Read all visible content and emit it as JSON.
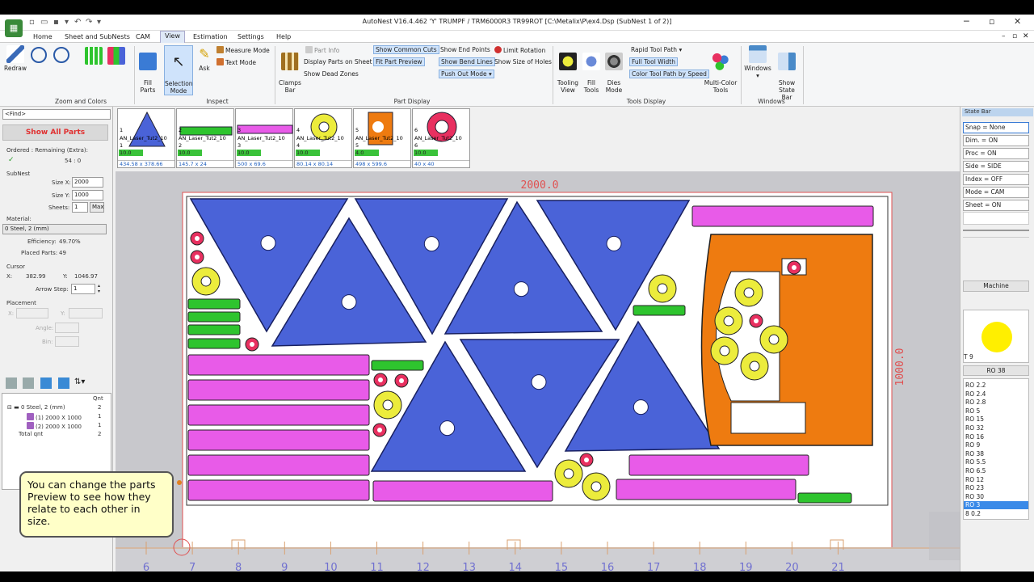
{
  "app": {
    "title": "AutoNest V16.4.462  'Y'  TRUMPF / TRM6000R3  TR99ROT    [C:\\Metalix\\P\\ex4.Dsp (SubNest 1 of 2)]",
    "menu": [
      "Home",
      "Sheet and SubNests",
      "CAM",
      "View",
      "Estimation",
      "Settings",
      "Help"
    ],
    "active_menu": "View"
  },
  "ribbon": {
    "redraw": "Redraw",
    "zoom_group": "Zoom and Colors",
    "fill_parts": "Fill\nParts",
    "selection_mode": "Selection\nMode",
    "ask": "Ask",
    "measure_mode": "Measure Mode",
    "text_mode": "Text Mode",
    "inspect_group": "Inspect",
    "clamps_bar": "Clamps\nBar",
    "part_info": "Part Info",
    "display_parts_on_sheet": "Display Parts on Sheet",
    "show_dead_zones": "Show Dead Zones",
    "show_common_cuts": "Show Common Cuts",
    "fit_part_preview": "Fit Part Preview",
    "show_end_points": "Show End Points",
    "show_bend_lines": "Show Bend Lines",
    "push_out_mode": "Push Out Mode",
    "limit_rotation": "Limit Rotation",
    "show_size_of_holes": "Show Size of Holes",
    "part_display_group": "Part Display",
    "tooling_view": "Tooling\nView",
    "fill_tools": "Fill\nTools",
    "dies_mode": "Dies\nMode",
    "rapid_tool_path": "Rapid Tool Path",
    "full_tool_width": "Full Tool Width",
    "color_tool_path_by_speed": "Color Tool Path by Speed",
    "multi_color_tools": "Multi-Color\nTools",
    "tools_display_group": "Tools Display",
    "windows": "Windows",
    "show_state_bar": "Show\nState Bar",
    "windows_group": "Windows"
  },
  "left_panel": {
    "find": "<Find>",
    "show_all_parts": "Show All Parts",
    "ordered_label": "Ordered : Remaining (Extra):",
    "ordered_value": "54 : 0",
    "subnest_label": "SubNest",
    "size_x_label": "Size X:",
    "size_x": "2000",
    "size_y_label": "Size Y:",
    "size_y": "1000",
    "sheets_label": "Sheets:",
    "sheets": "1",
    "max": "Max",
    "material_label": "Material:",
    "material": "0  Steel, 2 (mm)",
    "efficiency_label": "Efficiency:",
    "efficiency": "49.70%",
    "placed_parts_label": "Placed Parts:",
    "placed_parts": "49",
    "cursor_label": "Cursor",
    "cursor_x_label": "X:",
    "cursor_x": "382.99",
    "cursor_y_label": "Y:",
    "cursor_y": "1046.97",
    "arrow_step_label": "Arrow Step:",
    "arrow_step": "1",
    "placement_label": "Placement",
    "px_label": "X:",
    "py_label": "Y:",
    "angle_label": "Angle:",
    "bin_label": "Bin:",
    "tree_header_qnt": "Qnt",
    "tree": [
      {
        "label": "0  Steel, 2 (mm)",
        "qnt": "2"
      },
      {
        "label": "(1) 2000 X 1000",
        "qnt": "1"
      },
      {
        "label": "(2) 2000 X 1000",
        "qnt": "1"
      },
      {
        "label": "Total qnt",
        "qnt": "2"
      }
    ]
  },
  "callout": "You can change the parts Preview to see how they relate to each other in size.",
  "previews": [
    {
      "num": "1",
      "name": "AN_Laser_Tut2_10",
      "qty": "10.0",
      "dim": "434.58 x 378.66",
      "color": "#4a63d8"
    },
    {
      "num": "2",
      "name": "AN_Laser_Tut2_10",
      "qty": "10.0",
      "dim": "145.7 x 24",
      "color": "#2ec42e"
    },
    {
      "num": "3",
      "name": "AN_Laser_Tut2_10",
      "qty": "10.0",
      "dim": "500 x 69.6",
      "color": "#e85be8"
    },
    {
      "num": "4",
      "name": "AN_Laser_Tut2_10",
      "qty": "10.0",
      "dim": "80.14 x 80.14",
      "color": "#ecec3c"
    },
    {
      "num": "5",
      "name": "AN_Laser_Tut2_10",
      "qty": "4.0",
      "dim": "498 x 599.6",
      "color": "#ee7b10"
    },
    {
      "num": "6",
      "name": "AN_Laser_Tut2_10",
      "qty": "10.0",
      "dim": "40 x 40",
      "color": "#e83060"
    }
  ],
  "sheet": {
    "width_label": "2000.0",
    "height_label": "1000.0",
    "ruler": [
      "6",
      "7",
      "8",
      "9",
      "10",
      "11",
      "12",
      "13",
      "14",
      "15",
      "16",
      "17",
      "18",
      "19",
      "20",
      "21"
    ]
  },
  "state_bar": {
    "title": "State Bar",
    "items": [
      "Snap = None",
      "Dim. = ON",
      "Proc = ON",
      "Side = SIDE",
      "Index = OFF",
      "Mode = CAM",
      "Sheet = ON"
    ],
    "machine": "Machine",
    "tool_label": "T 9",
    "tool_selected": "RO 38",
    "tools": [
      "RO 2.2",
      "RO 2.4",
      "RO 2.8",
      "RO 5",
      "RO 15",
      "RO 32",
      "RO 16",
      "RO 9",
      "RO 38",
      "RO 5.5",
      "RO 6.5",
      "RO 12",
      "RO 23",
      "RO 30",
      "RO 3",
      "8 0.2"
    ],
    "tools_highlight": "RO 3"
  },
  "colors": {
    "blue_part": "#4a63d8",
    "green_part": "#2ec42e",
    "pink_part": "#e85be8",
    "yellow_part": "#ecec3c",
    "orange_part": "#ee7b10",
    "red_part": "#e83060",
    "sheet_border": "#e05050",
    "ruler": "#7070d0"
  }
}
